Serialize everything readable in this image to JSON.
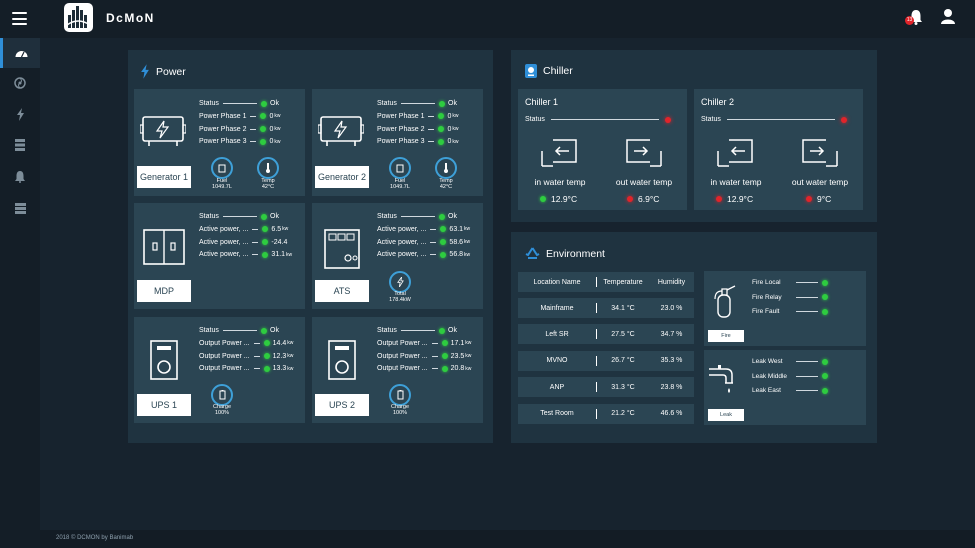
{
  "app": {
    "brand": "DcMoN",
    "notification_count": "13",
    "footer": "2018 © DCMON by Banimab"
  },
  "sidebar": {
    "items": [
      "dashboard",
      "chiller",
      "power",
      "server",
      "alarm",
      "rack"
    ]
  },
  "power": {
    "title": "Power",
    "generators": [
      {
        "name": "Generator 1",
        "rows": [
          {
            "label": "Status",
            "value": "Ok"
          },
          {
            "label": "Power Phase 1",
            "value": "0",
            "unit": "kw"
          },
          {
            "label": "Power Phase 2",
            "value": "0",
            "unit": "kw"
          },
          {
            "label": "Power Phase 3",
            "value": "0",
            "unit": "kw"
          }
        ],
        "fuel_label": "Fuel",
        "fuel_value": "1049.7L",
        "temp_label": "Temp",
        "temp_value": "42°C"
      },
      {
        "name": "Generator 2",
        "rows": [
          {
            "label": "Status",
            "value": "Ok"
          },
          {
            "label": "Power Phase 1",
            "value": "0",
            "unit": "kw"
          },
          {
            "label": "Power Phase 2",
            "value": "0",
            "unit": "kw"
          },
          {
            "label": "Power Phase 3",
            "value": "0",
            "unit": "kw"
          }
        ],
        "fuel_label": "Fuel",
        "fuel_value": "1049.7L",
        "temp_label": "Temp",
        "temp_value": "42°C"
      }
    ],
    "mdp": {
      "name": "MDP",
      "rows": [
        {
          "label": "Status",
          "value": "Ok"
        },
        {
          "label": "Active power, ...",
          "value": "6.5",
          "unit": "kw"
        },
        {
          "label": "Active power, ...",
          "value": "-24.4",
          "unit": ""
        },
        {
          "label": "Active power, ...",
          "value": "31.1",
          "unit": "kw"
        }
      ]
    },
    "ats": {
      "name": "ATS",
      "rows": [
        {
          "label": "Status",
          "value": "Ok"
        },
        {
          "label": "Active power, ...",
          "value": "63.1",
          "unit": "kw"
        },
        {
          "label": "Active power, ...",
          "value": "58.6",
          "unit": "kw"
        },
        {
          "label": "Active power, ...",
          "value": "56.8",
          "unit": "kw"
        }
      ],
      "total_label": "Total",
      "total_value": "178.4kW"
    },
    "ups": [
      {
        "name": "UPS 1",
        "rows": [
          {
            "label": "Status",
            "value": "Ok"
          },
          {
            "label": "Output Power ...",
            "value": "14.4",
            "unit": "kw"
          },
          {
            "label": "Output Power ...",
            "value": "12.3",
            "unit": "kw"
          },
          {
            "label": "Output Power ...",
            "value": "13.3",
            "unit": "kw"
          }
        ],
        "charge_label": "Charge",
        "charge_value": "100%"
      },
      {
        "name": "UPS 2",
        "rows": [
          {
            "label": "Status",
            "value": "Ok"
          },
          {
            "label": "Output Power ...",
            "value": "17.1",
            "unit": "kw"
          },
          {
            "label": "Output Power ...",
            "value": "23.5",
            "unit": "kw"
          },
          {
            "label": "Output Power ...",
            "value": "20.8",
            "unit": "kw"
          }
        ],
        "charge_label": "Charge",
        "charge_value": "100%"
      }
    ]
  },
  "chiller": {
    "title": "Chiller",
    "units": [
      {
        "name": "Chiller 1",
        "status_label": "Status",
        "in_label": "in water temp",
        "in_value": "12.9°C",
        "out_label": "out water temp",
        "out_value": "6.9°C"
      },
      {
        "name": "Chiller 2",
        "status_label": "Status",
        "in_label": "in water temp",
        "in_value": "12.9°C",
        "out_label": "out water temp",
        "out_value": "9°C"
      }
    ]
  },
  "environment": {
    "title": "Environment",
    "headers": [
      "Location Name",
      "Temperature",
      "Humidity"
    ],
    "rows": [
      {
        "name": "Mainframe",
        "temp": "34.1 °C",
        "hum": "23.0 %"
      },
      {
        "name": "Left SR",
        "temp": "27.5 °C",
        "hum": "34.7 %"
      },
      {
        "name": "MVNO",
        "temp": "26.7 °C",
        "hum": "35.3 %"
      },
      {
        "name": "ANP",
        "temp": "31.3 °C",
        "hum": "23.8 %"
      },
      {
        "name": "Test Room",
        "temp": "21.2 °C",
        "hum": "46.6 %"
      }
    ],
    "fire": {
      "label": "Fire",
      "rows": [
        "Fire Local",
        "Fire Relay",
        "Fire Fault"
      ]
    },
    "leak": {
      "label": "Leak",
      "rows": [
        "Leak West",
        "Leak Middle",
        "Leak East"
      ]
    }
  },
  "colors": {
    "background": "#17232e",
    "panel": "#1f3340",
    "card": "#2b4553",
    "accent": "#2f8fd8",
    "ok": "#2ecc40",
    "alarm": "#e0242a"
  }
}
